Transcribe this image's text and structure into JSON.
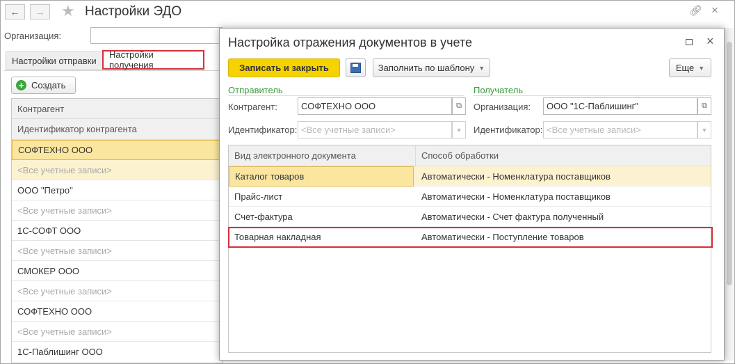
{
  "main": {
    "title": "Настройки ЭДО",
    "org_label": "Организация:",
    "tabs": [
      {
        "label": "Настройки отправки"
      },
      {
        "label": "Настройки получения"
      }
    ],
    "create_label": "Создать",
    "list_headers": [
      "Контрагент",
      "Идентификатор контрагента"
    ],
    "list": [
      {
        "name": "СОФТЕХНО ООО",
        "id": "<Все учетные записи>"
      },
      {
        "name": "ООО \"Петро\"",
        "id": "<Все учетные записи>"
      },
      {
        "name": "1С-СОФТ ООО",
        "id": "<Все учетные записи>"
      },
      {
        "name": "СМОКЕР ООО",
        "id": "<Все учетные записи>"
      },
      {
        "name": "СОФТЕХНО ООО",
        "id": "<Все учетные записи>"
      },
      {
        "name": "1С-Паблишинг ООО",
        "id": ""
      }
    ]
  },
  "dialog": {
    "title": "Настройка отражения документов в учете",
    "save_close_label": "Записать и закрыть",
    "fill_template_label": "Заполнить по шаблону",
    "more_label": "Еще",
    "sender": {
      "header": "Отправитель",
      "counterparty_label": "Контрагент:",
      "counterparty_value": "СОФТЕХНО ООО",
      "identifier_label": "Идентификатор:",
      "identifier_placeholder": "<Все учетные записи>"
    },
    "receiver": {
      "header": "Получатель",
      "organization_label": "Организация:",
      "organization_value": "ООО \"1С-Паблишинг\"",
      "identifier_label": "Идентификатор:",
      "identifier_placeholder": "<Все учетные записи>"
    },
    "table": {
      "headers": [
        "Вид электронного документа",
        "Способ обработки"
      ],
      "rows": [
        {
          "doc": "Каталог товаров",
          "method": "Автоматически -  Номенклатура поставщиков"
        },
        {
          "doc": "Прайс-лист",
          "method": "Автоматически -  Номенклатура поставщиков"
        },
        {
          "doc": "Счет-фактура",
          "method": "Автоматически -  Счет фактура полученный"
        },
        {
          "doc": "Товарная накладная",
          "method": "Автоматически -  Поступление товаров"
        }
      ]
    }
  },
  "colors": {
    "selected_row": "#fbe6a0",
    "selected_row_light": "#fdf2d0",
    "primary_button": "#f5d200",
    "highlight_frame": "#d6303a",
    "group_header": "#3a9a3a"
  }
}
